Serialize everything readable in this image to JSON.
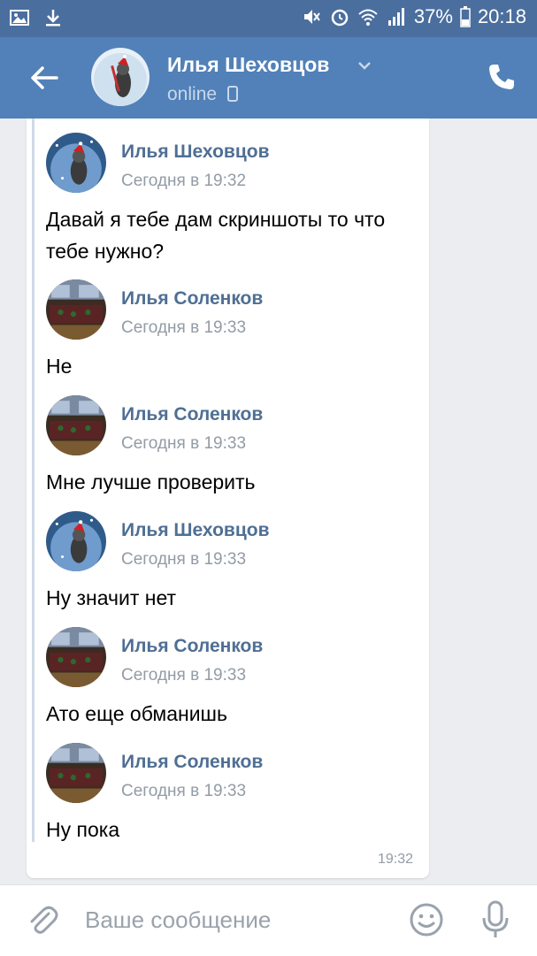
{
  "status_bar": {
    "battery": "37%",
    "time": "20:18",
    "icons": [
      "image-icon",
      "download-icon",
      "mute-icon",
      "alarm-icon",
      "wifi-icon",
      "signal-icon",
      "battery-icon"
    ]
  },
  "header": {
    "name": "Илья Шеховцов",
    "status": "online",
    "icons": [
      "back-arrow-icon",
      "chevron-down-icon",
      "mobile-icon",
      "phone-icon"
    ]
  },
  "messages": [
    {
      "author": "Илья Шеховцов",
      "time": "Сегодня в 19:32",
      "text": "Давай я тебе дам скриншоты то что тебе нужно?",
      "avatar": "raccoon"
    },
    {
      "author": "Илья Соленков",
      "time": "Сегодня в 19:33",
      "text": "Не",
      "avatar": "room"
    },
    {
      "author": "Илья Соленков",
      "time": "Сегодня в 19:33",
      "text": "Мне лучше проверить",
      "avatar": "room"
    },
    {
      "author": "Илья Шеховцов",
      "time": "Сегодня в 19:33",
      "text": "Ну значит нет",
      "avatar": "raccoon"
    },
    {
      "author": "Илья Соленков",
      "time": "Сегодня в 19:33",
      "text": "Ато еще обманишь",
      "avatar": "room"
    },
    {
      "author": "Илья Соленков",
      "time": "Сегодня в 19:33",
      "text": "Ну пока",
      "avatar": "room"
    }
  ],
  "card_time": "19:32",
  "composer": {
    "placeholder": "Ваше сообщение",
    "icons": [
      "attach-icon",
      "emoji-icon",
      "microphone-icon"
    ]
  },
  "colors": {
    "header": "#5181b8",
    "status_bar": "#4a6f9e",
    "author": "#4f6f94",
    "background": "#ebedf0"
  }
}
